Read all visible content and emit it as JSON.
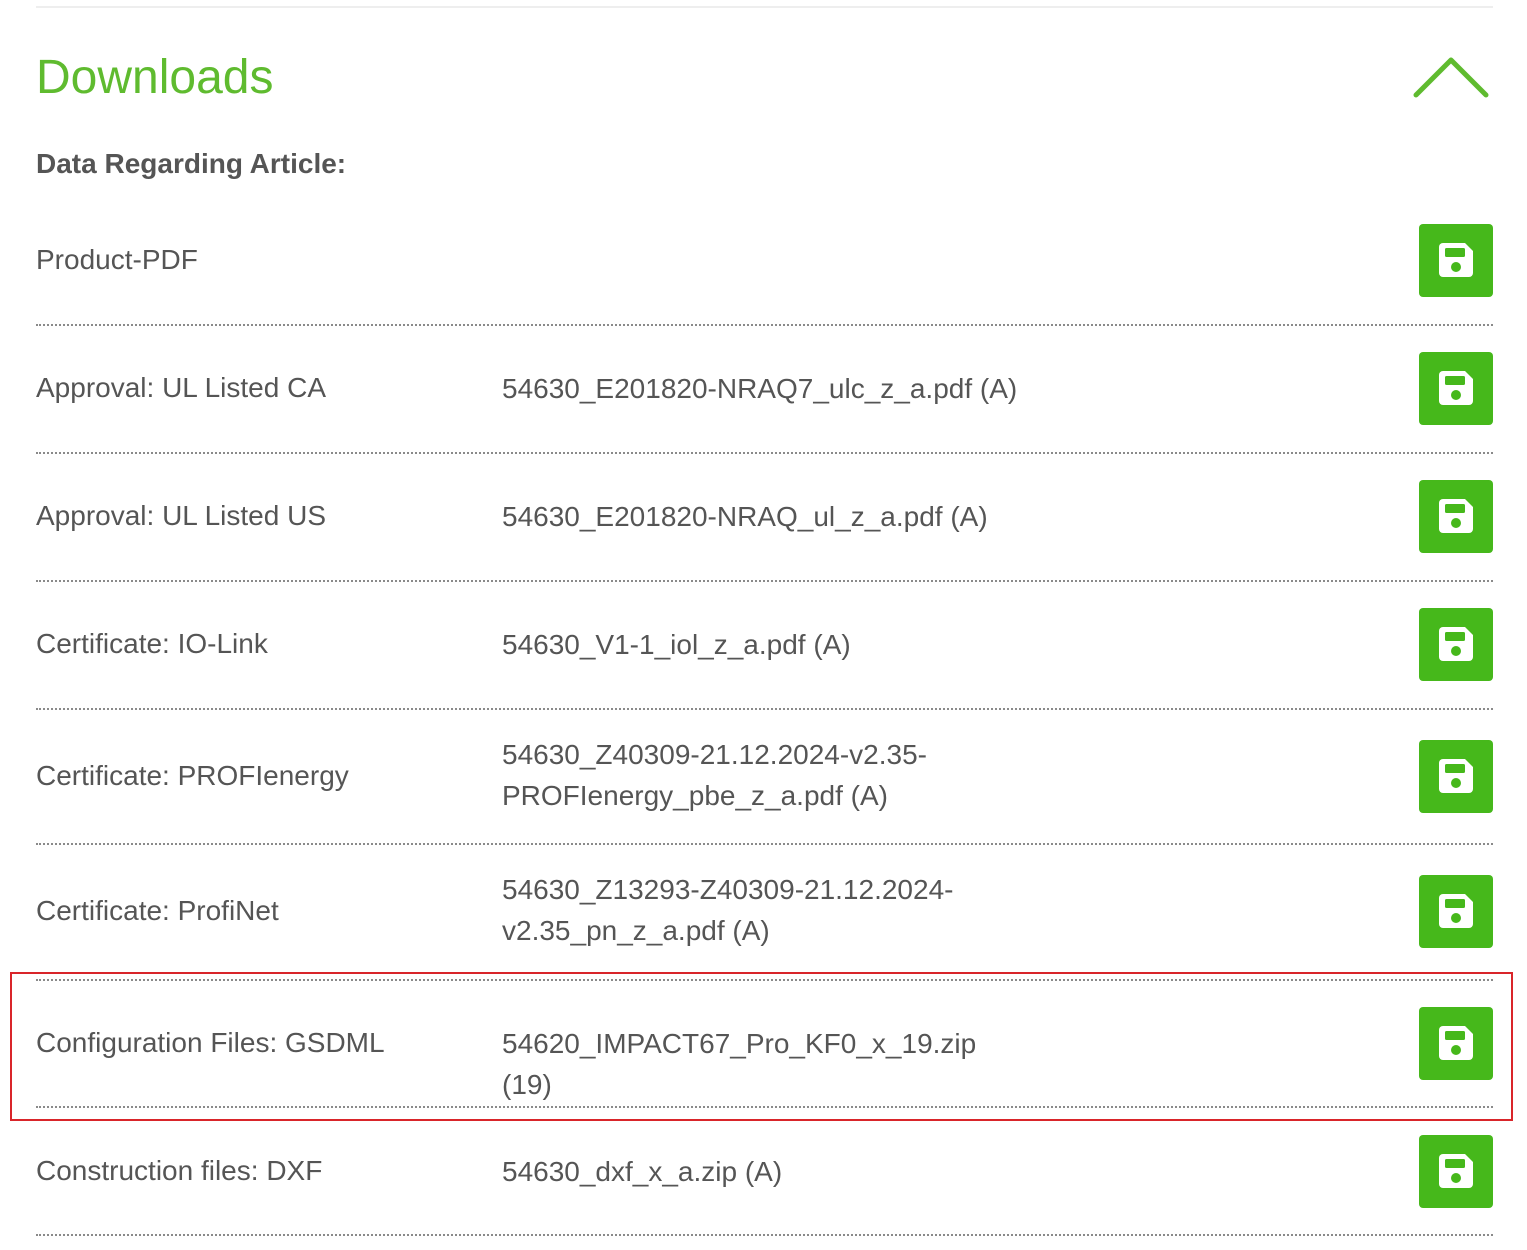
{
  "section": {
    "title": "Downloads",
    "subheading": "Data Regarding Article:"
  },
  "colors": {
    "accent": "#5fbb2f",
    "button": "#46b81b",
    "highlight": "#d9252a",
    "text": "#555555"
  },
  "icons": {
    "toggle": "chevron-up-icon",
    "download": "floppy-disk-icon"
  },
  "downloads": [
    {
      "label": "Product-PDF",
      "file_line1": "",
      "file_line2": ""
    },
    {
      "label": "Approval: UL Listed CA",
      "file_line1": "54630_E201820-NRAQ7_ulc_z_a.pdf (A)",
      "file_line2": ""
    },
    {
      "label": "Approval: UL Listed US",
      "file_line1": "54630_E201820-NRAQ_ul_z_a.pdf (A)",
      "file_line2": ""
    },
    {
      "label": "Certificate: IO-Link",
      "file_line1": "54630_V1-1_iol_z_a.pdf (A)",
      "file_line2": ""
    },
    {
      "label": "Certificate: PROFIenergy",
      "file_line1": "54630_Z40309-21.12.2024-v2.35-",
      "file_line2": "PROFIenergy_pbe_z_a.pdf (A)"
    },
    {
      "label": "Certificate: ProfiNet",
      "file_line1": "54630_Z13293-Z40309-21.12.2024-",
      "file_line2": "v2.35_pn_z_a.pdf (A)"
    },
    {
      "label": "Configuration Files: GSDML",
      "file_line1": "54620_IMPACT67_Pro_KF0_x_19.zip (19)",
      "file_line2": "",
      "highlighted": true
    },
    {
      "label": "Construction files: DXF",
      "file_line1": "54630_dxf_x_a.zip (A)",
      "file_line2": ""
    }
  ]
}
